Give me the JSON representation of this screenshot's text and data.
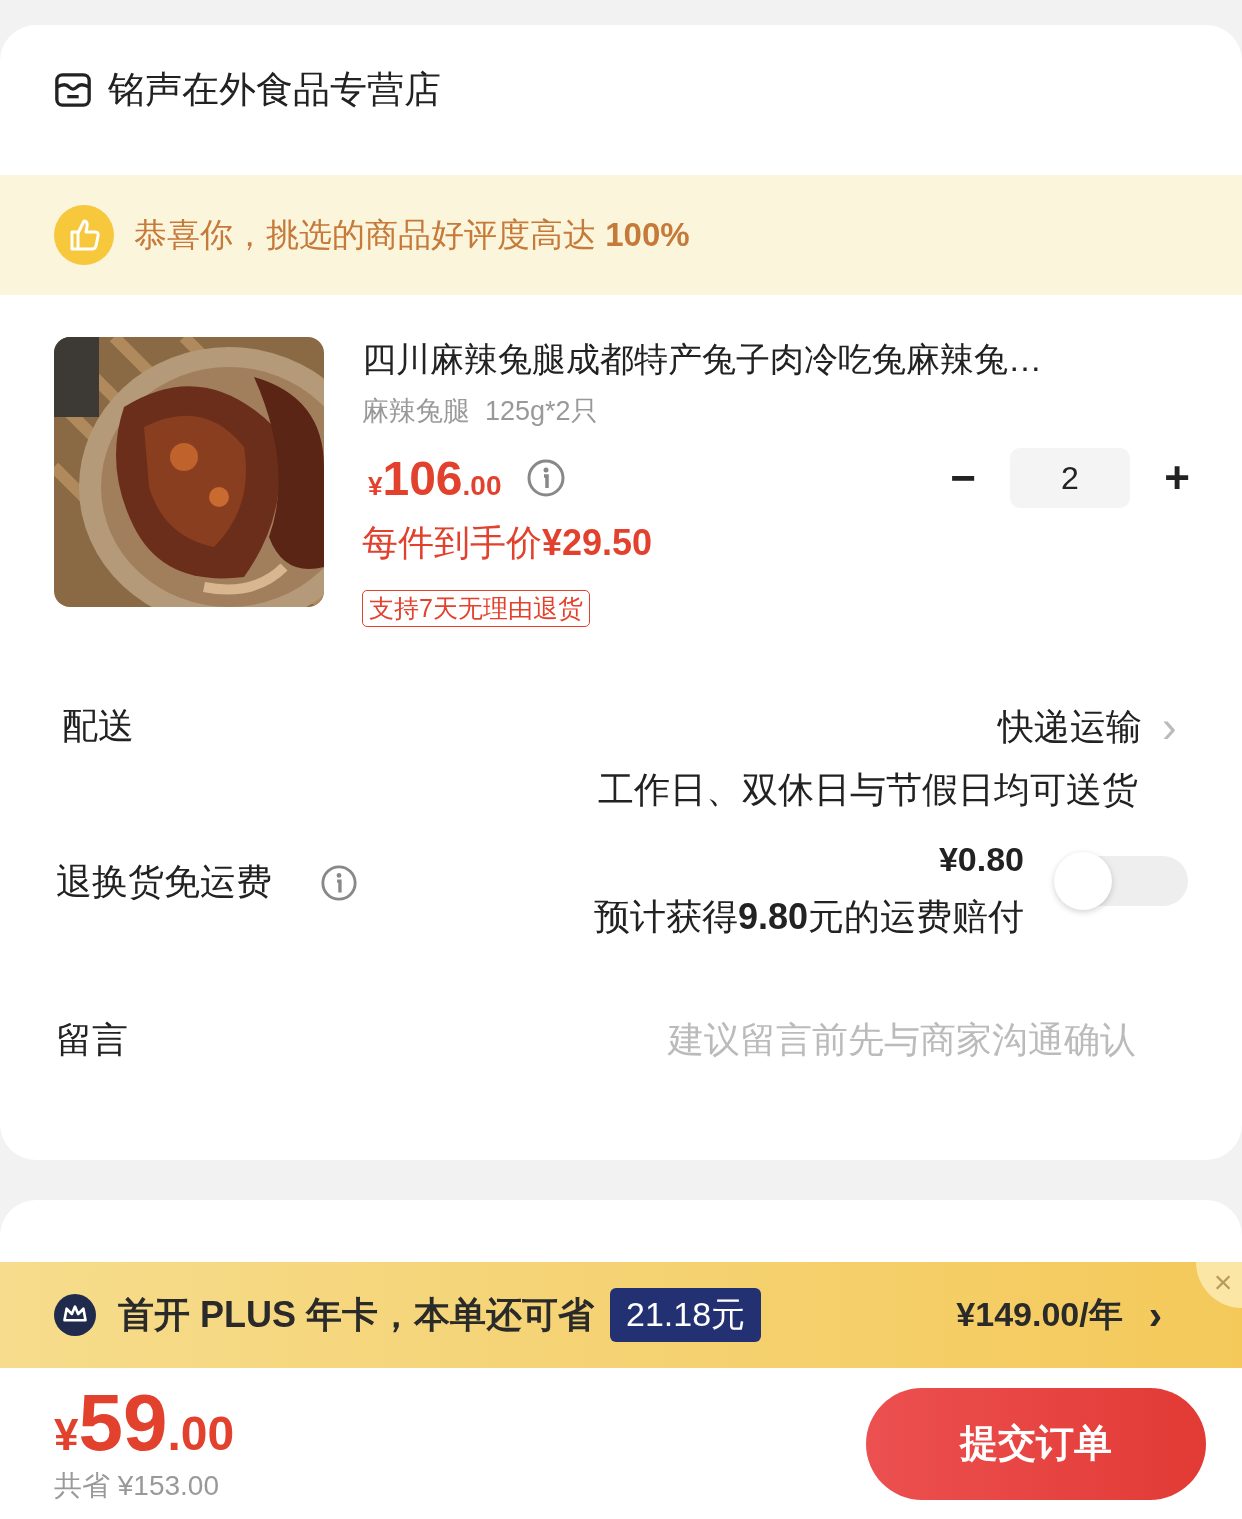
{
  "store": {
    "name": "铭声在外食品专营店"
  },
  "praise_banner": {
    "text": "恭喜你，挑选的商品好评度高达 **100%**"
  },
  "product": {
    "kind": "picture",
    "title": "四川麻辣兔腿成都特产兔子肉冷吃兔麻辣兔…",
    "spec": "麻辣兔腿  125g*2只",
    "price": {
      "currency": "¥",
      "integer": "106",
      "decimal": ".00"
    },
    "unit_price": "每件到手价**¥29.50**",
    "quantity": "2",
    "minus": "−",
    "plus": "+",
    "tag": "支持7天无理由退货"
  },
  "delivery": {
    "label": "配送",
    "method": "快递运输",
    "note": "工作日、双休日与节假日均可送货",
    "chevron": "›"
  },
  "return_insurance": {
    "label": "退换货免运费",
    "price": "¥0.80",
    "note": "预计获得**9.80**元的运费赔付",
    "on": false
  },
  "message": {
    "label": "留言",
    "placeholder": "建议留言前先与商家沟通确认"
  },
  "plus_banner": {
    "text": "首开 PLUS 年卡，本单还可省",
    "saving": "21.18元",
    "price": "¥149.00/年",
    "chevron": "›",
    "close": "×"
  },
  "footer": {
    "total": {
      "currency": "¥",
      "integer": "59",
      "decimal": ".00"
    },
    "saved": "共省 ¥153.00",
    "submit": "提交订单"
  }
}
